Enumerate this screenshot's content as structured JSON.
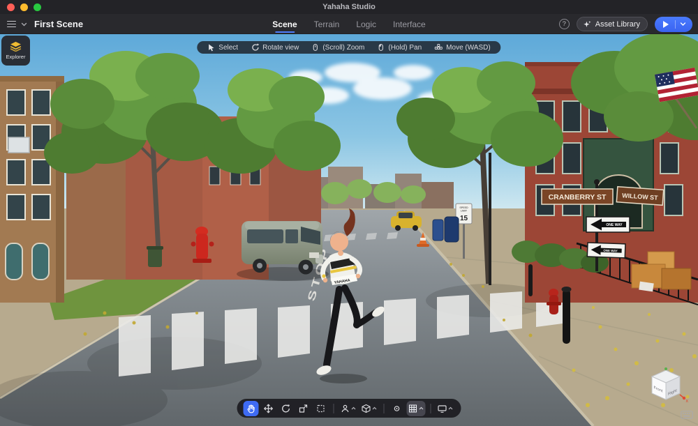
{
  "titlebar": {
    "title": "Yahaha Studio"
  },
  "header": {
    "scene_name": "First Scene",
    "tabs": [
      {
        "label": "Scene",
        "active": true
      },
      {
        "label": "Terrain",
        "active": false
      },
      {
        "label": "Logic",
        "active": false
      },
      {
        "label": "Interface",
        "active": false
      }
    ],
    "help_label": "?",
    "asset_library_label": "Asset Library"
  },
  "explorer_badge": {
    "label": "Explorer"
  },
  "viewport_toolbar": {
    "items": [
      {
        "icon": "cursor-icon",
        "label": "Select"
      },
      {
        "icon": "rotate-view-icon",
        "label": "Rotate view"
      },
      {
        "icon": "mouse-scroll-icon",
        "label": "(Scroll) Zoom"
      },
      {
        "icon": "mouse-hold-icon",
        "label": "(Hold) Pan"
      },
      {
        "icon": "wasd-keys-icon",
        "label": "Move (WASD)"
      }
    ]
  },
  "bottom_toolbar": {
    "tools": [
      {
        "name": "hand-tool",
        "active": true
      },
      {
        "name": "move-tool"
      },
      {
        "name": "rotate-tool"
      },
      {
        "name": "scale-tool"
      },
      {
        "name": "marquee-select-tool"
      },
      {
        "name": "avatar-tool",
        "has_menu": true
      },
      {
        "name": "spawn-object-tool",
        "has_menu": true
      },
      {
        "name": "snap-dot-tool"
      },
      {
        "name": "grid-tool",
        "has_menu": true,
        "highlighted": true
      },
      {
        "name": "viewport-display-tool",
        "has_menu": true
      }
    ]
  },
  "scene_labels": {
    "road_marking": "STOP",
    "street_sign_left": "CRANBERRY ST",
    "street_sign_right": "WILLOW ST",
    "one_way_top": "ONE WAY",
    "one_way_bottom": "ONE WAY",
    "speed_limit_line1": "SPEED",
    "speed_limit_line2": "LIMIT",
    "speed_limit_value": "15",
    "character_logo": "YAHAHA"
  },
  "gizmo": {
    "front_label": "Front",
    "right_label": "Right",
    "x_axis_label": "x"
  },
  "colors": {
    "accent_blue": "#3E6BF3",
    "tab_underline": "#4D7DFD",
    "explorer_yellow": "#F0BC33",
    "titlebar_bg": "#232327",
    "header_bg": "#29292D",
    "traffic_red": "#FF5F57",
    "traffic_yellow": "#FEBC2E",
    "traffic_green": "#28C840"
  }
}
